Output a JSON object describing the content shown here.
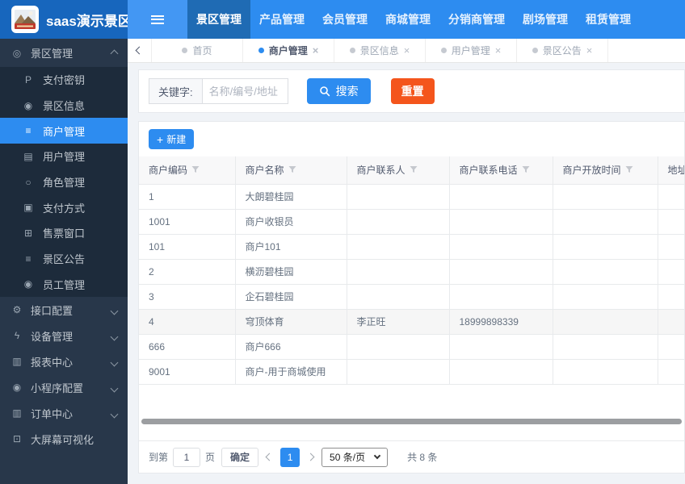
{
  "app": {
    "title": "saas演示景区"
  },
  "header": {
    "nav": [
      {
        "label": "景区管理",
        "active": true
      },
      {
        "label": "产品管理",
        "active": false
      },
      {
        "label": "会员管理",
        "active": false
      },
      {
        "label": "商城管理",
        "active": false
      },
      {
        "label": "分销商管理",
        "active": false
      },
      {
        "label": "剧场管理",
        "active": false
      },
      {
        "label": "租赁管理",
        "active": false
      }
    ]
  },
  "sidebar": {
    "group": {
      "label": "景区管理",
      "icon": "location-icon",
      "expanded": true
    },
    "items": [
      {
        "label": "支付密钥",
        "icon": "paypal-icon",
        "selected": false
      },
      {
        "label": "景区信息",
        "icon": "image-icon",
        "selected": false
      },
      {
        "label": "商户管理",
        "icon": "list-icon",
        "selected": true
      },
      {
        "label": "用户管理",
        "icon": "idcard-icon",
        "selected": false
      },
      {
        "label": "角色管理",
        "icon": "circle-icon",
        "selected": false
      },
      {
        "label": "支付方式",
        "icon": "card-icon",
        "selected": false
      },
      {
        "label": "售票窗口",
        "icon": "windows-icon",
        "selected": false
      },
      {
        "label": "景区公告",
        "icon": "list-icon",
        "selected": false
      },
      {
        "label": "员工管理",
        "icon": "dot-circle-icon",
        "selected": false
      }
    ],
    "sections": [
      {
        "label": "接口配置",
        "icon": "plug-icon",
        "collapsible": true
      },
      {
        "label": "设备管理",
        "icon": "bolt-icon",
        "collapsible": true
      },
      {
        "label": "报表中心",
        "icon": "chart-icon",
        "collapsible": true
      },
      {
        "label": "小程序配置",
        "icon": "app-icon",
        "collapsible": true
      },
      {
        "label": "订单中心",
        "icon": "chart-icon",
        "collapsible": true
      },
      {
        "label": "大屏幕可视化",
        "icon": "monitor-icon",
        "collapsible": false
      }
    ]
  },
  "tabs": [
    {
      "label": "首页",
      "active": false,
      "closable": false
    },
    {
      "label": "商户管理",
      "active": true,
      "closable": true
    },
    {
      "label": "景区信息",
      "active": false,
      "closable": true
    },
    {
      "label": "用户管理",
      "active": false,
      "closable": true
    },
    {
      "label": "景区公告",
      "active": false,
      "closable": true
    }
  ],
  "search": {
    "label": "关键字:",
    "placeholder": "名称/编号/地址",
    "search_label": "搜索",
    "reset_label": "重置"
  },
  "toolbar": {
    "new_label": "新建"
  },
  "table": {
    "headers": [
      {
        "label": "商户编码",
        "filter": true
      },
      {
        "label": "商户名称",
        "filter": true
      },
      {
        "label": "商户联系人",
        "filter": true
      },
      {
        "label": "商户联系电话",
        "filter": true
      },
      {
        "label": "商户开放时间",
        "filter": true
      },
      {
        "label": "地址",
        "filter": false
      }
    ],
    "rows": [
      [
        "1",
        "大朗碧桂园",
        "",
        "",
        "",
        ""
      ],
      [
        "1001",
        "商户收银员",
        "",
        "",
        "",
        ""
      ],
      [
        "101",
        "商户101",
        "",
        "",
        "",
        ""
      ],
      [
        "2",
        "横沥碧桂园",
        "",
        "",
        "",
        ""
      ],
      [
        "3",
        "企石碧桂园",
        "",
        "",
        "",
        ""
      ],
      [
        "4",
        "穹顶体育",
        "李正旺",
        "18999898339",
        "",
        ""
      ],
      [
        "666",
        "商户666",
        "",
        "",
        "",
        ""
      ],
      [
        "9001",
        "商户-用于商城使用",
        "",
        "",
        "",
        ""
      ]
    ],
    "highlighted_row_index": 5
  },
  "pagination": {
    "goto_prefix": "到第",
    "page_input_value": "1",
    "goto_suffix": "页",
    "confirm_label": "确定",
    "current_page": "1",
    "page_size": "50 条/页",
    "total_label": "共 8 条"
  },
  "colors": {
    "primary": "#2d8cf0",
    "reset_button": "#f4551c",
    "brand_bg": "#1766bd",
    "sidebar_bg": "#28374a",
    "sidebar_submenu_bg": "#1d2b3b"
  }
}
